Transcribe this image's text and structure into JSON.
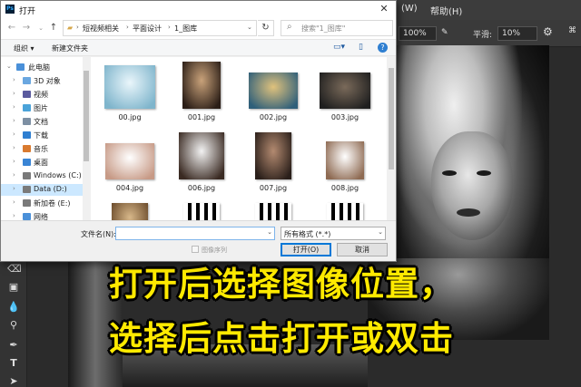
{
  "photoshop": {
    "menu": [
      "(W)",
      "帮助(H)"
    ],
    "options": {
      "zoom": "100%",
      "smooth_label": "平滑:",
      "smooth_value": "10%"
    }
  },
  "caption": {
    "line1": "打开后选择图像位置，",
    "line2": "选择后点击打开或双击"
  },
  "dialog": {
    "title": "打开",
    "close": "✕",
    "breadcrumb": [
      "短视频相关",
      "平面设计",
      "1_图库"
    ],
    "search_placeholder": "搜索\"1_图库\"",
    "organize": "组织 ▾",
    "new_folder": "新建文件夹",
    "tree": [
      {
        "label": "此电脑",
        "expanded": true,
        "color": "#4a90d9"
      },
      {
        "label": "3D 对象",
        "color": "#6aa7e0"
      },
      {
        "label": "视频",
        "color": "#5b5b9e"
      },
      {
        "label": "图片",
        "color": "#4aa3d9"
      },
      {
        "label": "文档",
        "color": "#7d8fa3"
      },
      {
        "label": "下载",
        "color": "#2f7fd1"
      },
      {
        "label": "音乐",
        "color": "#d97a2f"
      },
      {
        "label": "桌面",
        "color": "#3a85d5"
      },
      {
        "label": "Windows (C:)",
        "color": "#7a7a7a"
      },
      {
        "label": "Data (D:)",
        "selected": true,
        "color": "#7a7a7a"
      },
      {
        "label": "新加卷 (E:)",
        "color": "#7a7a7a"
      },
      {
        "label": "网络",
        "color": "#4a90d9"
      }
    ],
    "files": [
      {
        "name": "00.jpg",
        "c1": "#eaf6fb",
        "c2": "#7fb5cc"
      },
      {
        "name": "001.jpg",
        "c1": "#c9a27a",
        "c2": "#2b1e17"
      },
      {
        "name": "002.jpg",
        "c1": "#e0c27c",
        "c2": "#2f5f7a"
      },
      {
        "name": "003.jpg",
        "c1": "#7a6a5a",
        "c2": "#1f1f1f"
      },
      {
        "name": "004.jpg",
        "c1": "#ffffff",
        "c2": "#c79a86"
      },
      {
        "name": "006.jpg",
        "c1": "#f2f2f2",
        "c2": "#3a2a22"
      },
      {
        "name": "007.jpg",
        "c1": "#b38a70",
        "c2": "#2a1f1a"
      },
      {
        "name": "008.jpg",
        "c1": "#ffffff",
        "c2": "#8e6a52"
      },
      {
        "name": "",
        "c1": "#d8b88a",
        "c2": "#6a4a2a"
      },
      {
        "name": "",
        "c1": "#ffffff",
        "c2": "#000000"
      },
      {
        "name": "",
        "c1": "#ffffff",
        "c2": "#000000"
      },
      {
        "name": "",
        "c1": "#ffffff",
        "c2": "#000000"
      }
    ],
    "filename_label": "文件名(N):",
    "filename_value": "",
    "filetype": "所有格式 (*.*)",
    "image_sequence": "图像序列",
    "open_button": "打开(O)",
    "cancel_button": "取消"
  }
}
